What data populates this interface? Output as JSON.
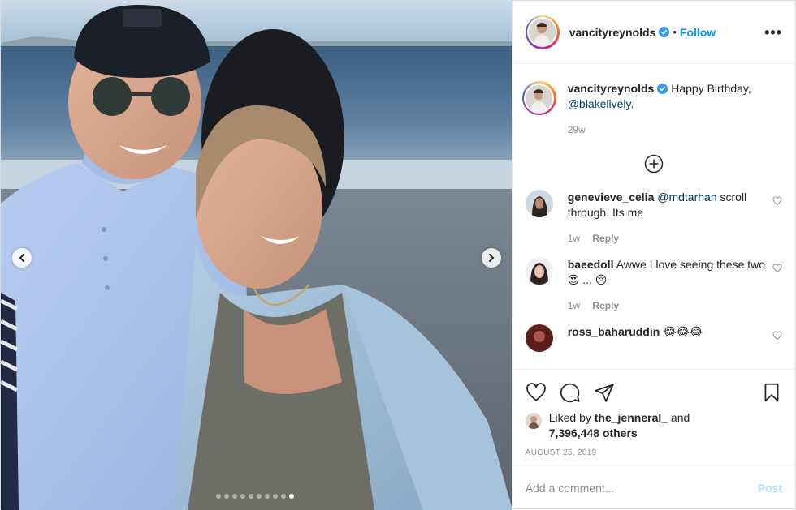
{
  "post": {
    "author": {
      "username": "vancityreynolds",
      "verified": true,
      "follow_label": "Follow",
      "dot": "•"
    },
    "more_icon": "more-options-icon",
    "more_label": "•••",
    "caption": {
      "username": "vancityreynolds",
      "text": "Happy Birthday,",
      "mention": "@blakelively.",
      "age": "29w"
    },
    "load_more_icon": "plus-circle-icon",
    "comments": [
      {
        "username": "genevieve_celia",
        "mention": "@mdtarhan",
        "text": "scroll through. Its me",
        "age": "1w",
        "reply_label": "Reply"
      },
      {
        "username": "baeedoll",
        "text": "Awwe I love seeing these two 😍 ... 😢",
        "age": "1w",
        "reply_label": "Reply"
      },
      {
        "username": "ross_baharuddin",
        "text": "😂😂😂"
      }
    ],
    "actions": {
      "icons": [
        "heart-icon",
        "comment-icon",
        "share-icon",
        "save-icon"
      ]
    },
    "likes": {
      "prefix": "Liked by",
      "liker": "the_jenneral_",
      "joiner": "and",
      "others": "7,396,448 others"
    },
    "date": "AUGUST 25, 2019",
    "comment_box": {
      "placeholder": "Add a comment...",
      "post_label": "Post"
    },
    "carousel": {
      "slide_count": 10,
      "active_index": 9
    },
    "colors": {
      "link_blue": "#0095f6",
      "mention_blue": "#00376b",
      "muted_gray": "#8e8e8e",
      "post_disabled": "#b2dffc"
    }
  }
}
